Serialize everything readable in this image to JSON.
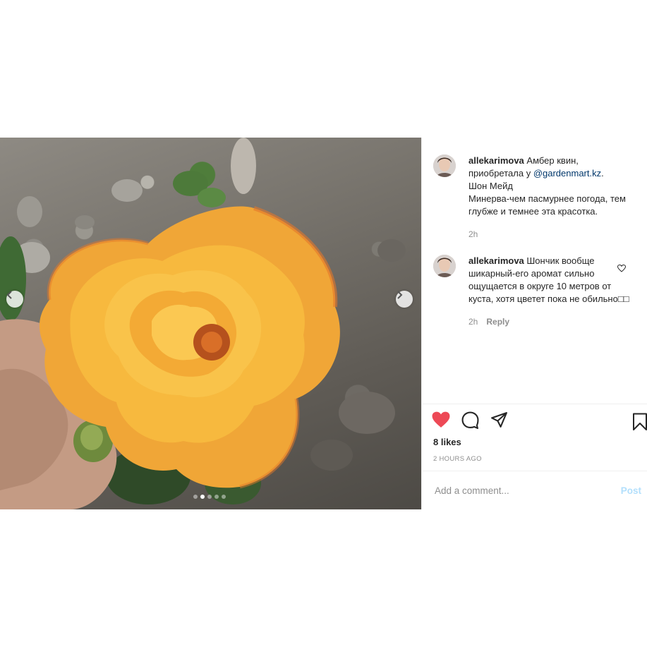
{
  "media": {
    "carousel_dots": 5,
    "active_dot_index": 1,
    "prev_icon": "chevron-left-icon",
    "next_icon": "chevron-right-icon"
  },
  "comments": [
    {
      "username": "allekarimova",
      "text_before": " Амбер квин, приобретала у ",
      "mention": "@gardenmart.kz",
      "text_after": ".\nШон Мейд\nМинерва-чем пасмурнее погода, тем глубже и темнее эта красотка.",
      "time": "2h"
    },
    {
      "username": "allekarimova",
      "text": " Шончик вообще шикарный-его аромат сильно ощущается в округе 10 метров от куста, хотя цветет пока не обильно□□",
      "time": "2h",
      "reply_label": "Reply",
      "like_icon": "heart-outline-icon"
    }
  ],
  "actions": {
    "like_icon": "heart-filled-icon",
    "like_color": "#ed4956",
    "comment_icon": "comment-bubble-icon",
    "share_icon": "paper-plane-icon",
    "save_icon": "bookmark-icon",
    "likes_text": "8 likes",
    "timestamp": "2 HOURS AGO"
  },
  "add_comment": {
    "placeholder": "Add a comment...",
    "post_label": "Post",
    "post_color": "#b2dffc"
  }
}
